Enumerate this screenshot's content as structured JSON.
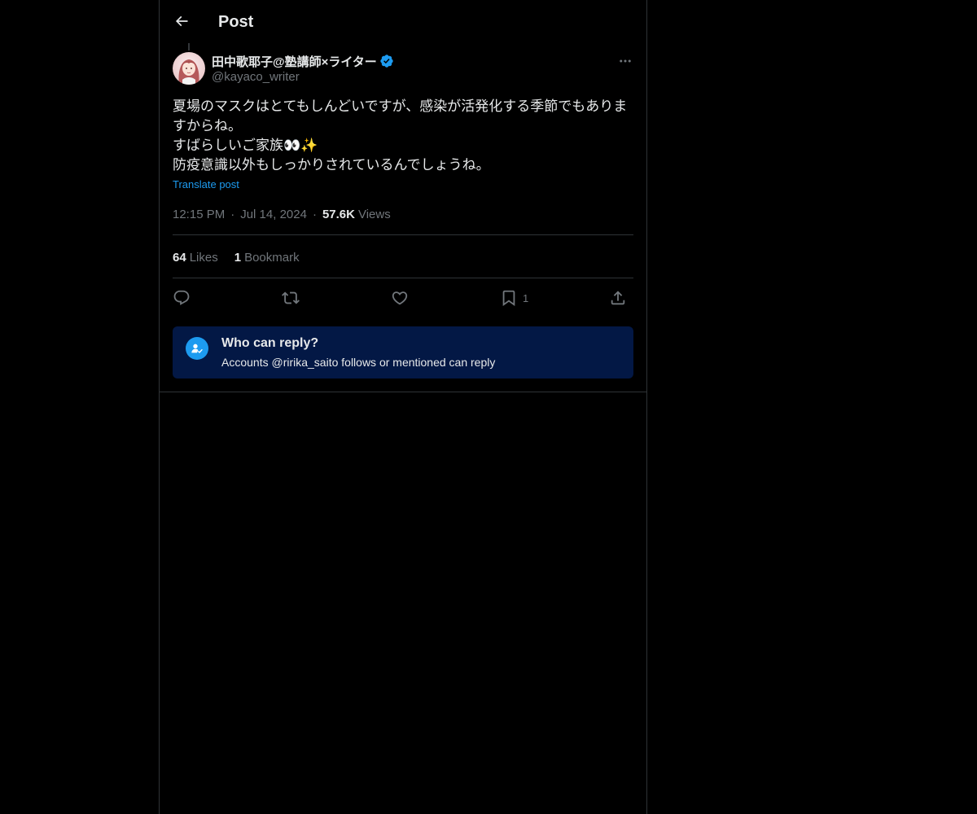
{
  "header": {
    "title": "Post"
  },
  "post": {
    "author_name": "田中歌耶子@塾講師×ライター",
    "author_handle": "@kayaco_writer",
    "text_lines": [
      "夏場のマスクはとてもしんどいですが、感染が活発化する季節でもありま",
      "すからね。",
      "すばらしいご家族👀✨",
      "防疫意識以外もしっかりされているんでしょうね。"
    ],
    "translate_label": "Translate post",
    "time": "12:15 PM",
    "separator": "·",
    "date": "Jul 14, 2024",
    "views_count": "57.6K",
    "views_label": "Views"
  },
  "stats": {
    "likes_count": "64",
    "likes_label": "Likes",
    "bookmarks_count": "1",
    "bookmarks_label": "Bookmark"
  },
  "actions": {
    "reply_icon": "reply-icon",
    "repost_icon": "repost-icon",
    "like_icon": "heart-icon",
    "bookmark_icon": "bookmark-icon",
    "bookmark_count": "1",
    "share_icon": "share-icon"
  },
  "reply_restriction": {
    "title": "Who can reply?",
    "description": "Accounts @ririka_saito follows or mentioned can reply"
  },
  "colors": {
    "background": "#000000",
    "text_primary": "#e7e9ea",
    "text_secondary": "#71767b",
    "accent": "#1d9bf0",
    "border": "#2f3336",
    "reply_panel_bg": "#031845"
  }
}
